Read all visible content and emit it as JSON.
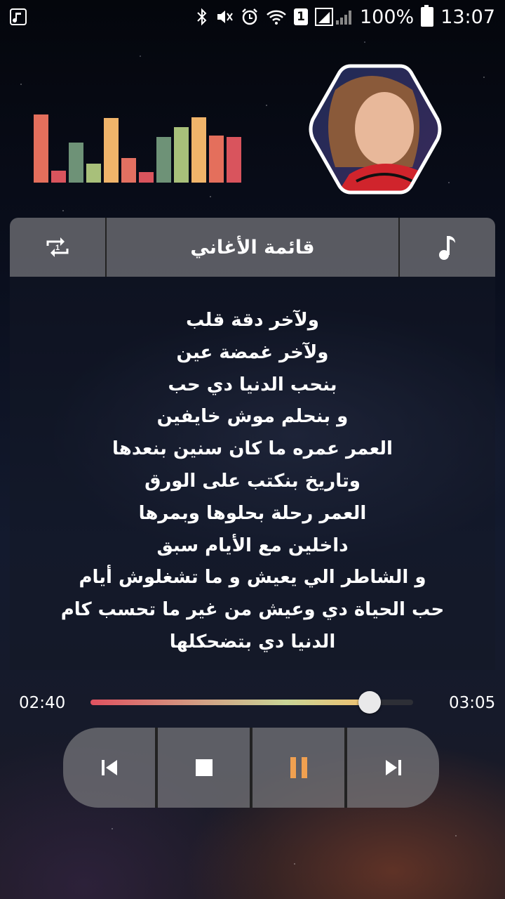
{
  "status_bar": {
    "battery": "100%",
    "time": "13:07",
    "sim_slot": "1",
    "icons": [
      "music-notification-icon",
      "bluetooth-icon",
      "mute-icon",
      "alarm-icon",
      "wifi-icon",
      "sim-icon",
      "signal-icon",
      "battery-icon"
    ]
  },
  "equalizer": {
    "levels": [
      0.97,
      0.17,
      0.57,
      0.27,
      0.92,
      0.35,
      0.15,
      0.65,
      0.79,
      0.93,
      0.67,
      0.65
    ],
    "colors": [
      "#e46f5c",
      "#d9545d",
      "#6e9277",
      "#a8c07a",
      "#f0b46a",
      "#e37061",
      "#d9545d",
      "#6e9277",
      "#a8c07a",
      "#f0b46a",
      "#e46f5c",
      "#d9545d"
    ]
  },
  "header": {
    "playlist_label": "قائمة الأغاني",
    "left_icon": "repeat-one-icon",
    "right_icon": "music-note-icon"
  },
  "lyrics": [
    "ولآخر دقة قلب",
    "ولآخر غمضة عين",
    "بنحب الدنيا دي حب",
    "و بنحلم موش خايفين",
    "العمر عمره ما كان سنين بنعدها",
    "وتاريخ بنكتب على الورق",
    "العمر رحلة بحلوها وبمرها",
    "داخلين مع الأيام سبق",
    "و الشاطر الي يعيش و ما تشغلوش أيام",
    "حب الحياة دي وعيش من غير ما تحسب كام",
    "الدنيا دي بتضحكلها"
  ],
  "player": {
    "current_time": "02:40",
    "total_time": "03:05",
    "progress": 0.865,
    "accent_color": "#f0a050",
    "controls": [
      "previous-icon",
      "stop-icon",
      "pause-icon",
      "next-icon"
    ]
  }
}
